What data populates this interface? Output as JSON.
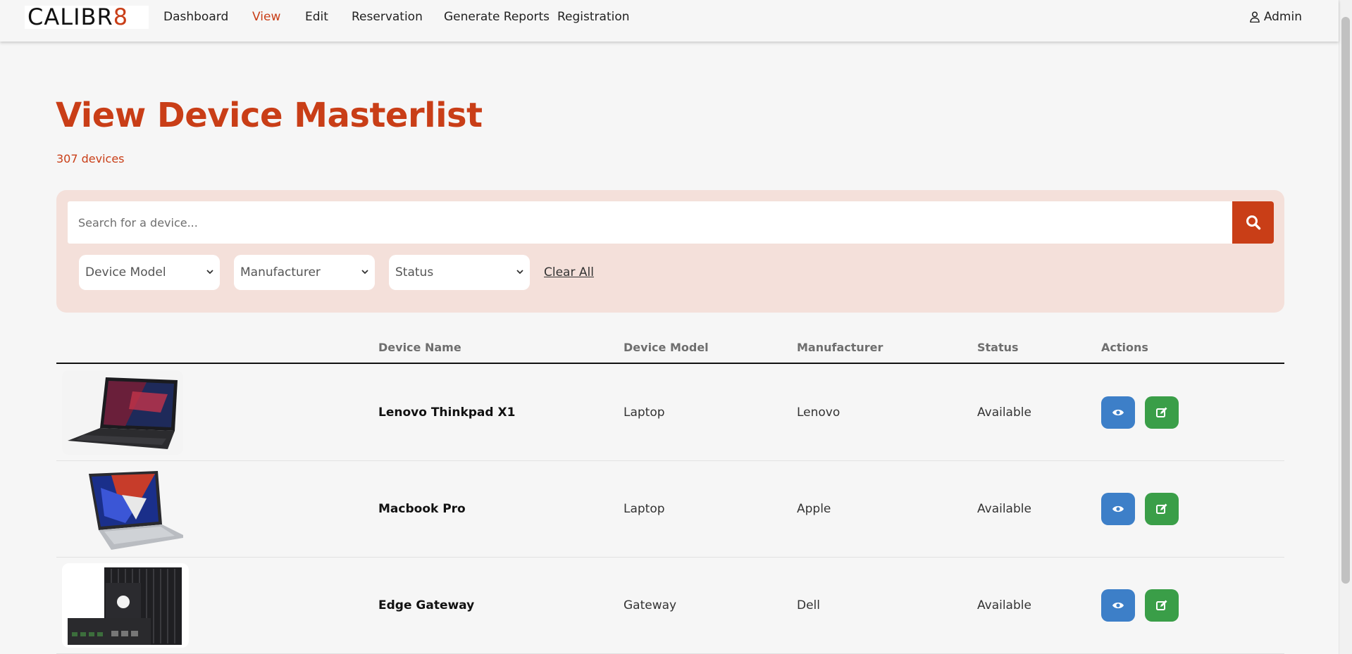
{
  "nav": {
    "logo_main": "CALIBR",
    "logo_accent": "8",
    "links": [
      "Dashboard",
      "View",
      "Edit",
      "Reservation",
      "Generate Reports",
      "Registration"
    ],
    "active": "View",
    "user": "Admin"
  },
  "page": {
    "title": "View Device Masterlist",
    "count": "307 devices"
  },
  "filters": {
    "search_placeholder": "Search for a device...",
    "device_model": "Device Model",
    "manufacturer": "Manufacturer",
    "status": "Status",
    "clear_all": "Clear All"
  },
  "table": {
    "headers": [
      "Device Name",
      "Device Model",
      "Manufacturer",
      "Status",
      "Actions"
    ],
    "rows": [
      {
        "name": "Lenovo Thinkpad X1",
        "model": "Laptop",
        "manufacturer": "Lenovo",
        "status": "Available"
      },
      {
        "name": "Macbook Pro",
        "model": "Laptop",
        "manufacturer": "Apple",
        "status": "Available"
      },
      {
        "name": "Edge Gateway",
        "model": "Gateway",
        "manufacturer": "Dell",
        "status": "Available"
      }
    ]
  },
  "colors": {
    "accent": "#c93e17",
    "panel": "#f4e0da",
    "view_button": "#3d7fc8",
    "edit_button": "#3a9e48"
  }
}
